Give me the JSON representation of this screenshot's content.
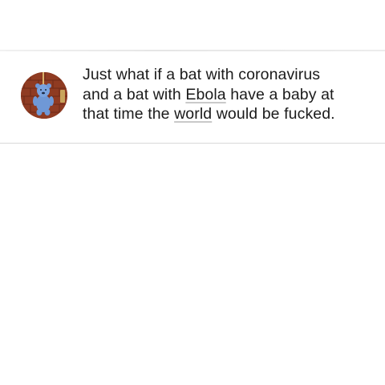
{
  "comment": {
    "avatar_icon": "profile-avatar-icon",
    "text_parts": {
      "line1": "Just what if a bat with coronavirus",
      "line2_before": "and a bat with ",
      "line2_link": "Ebola",
      "line2_after": " have a baby at",
      "line3_before": "that time the ",
      "line3_link": "world",
      "line3_after": " would be fucked."
    }
  },
  "colors": {
    "background": "#ffffff",
    "text": "#1b1b1b",
    "divider": "#d9d9d9"
  }
}
